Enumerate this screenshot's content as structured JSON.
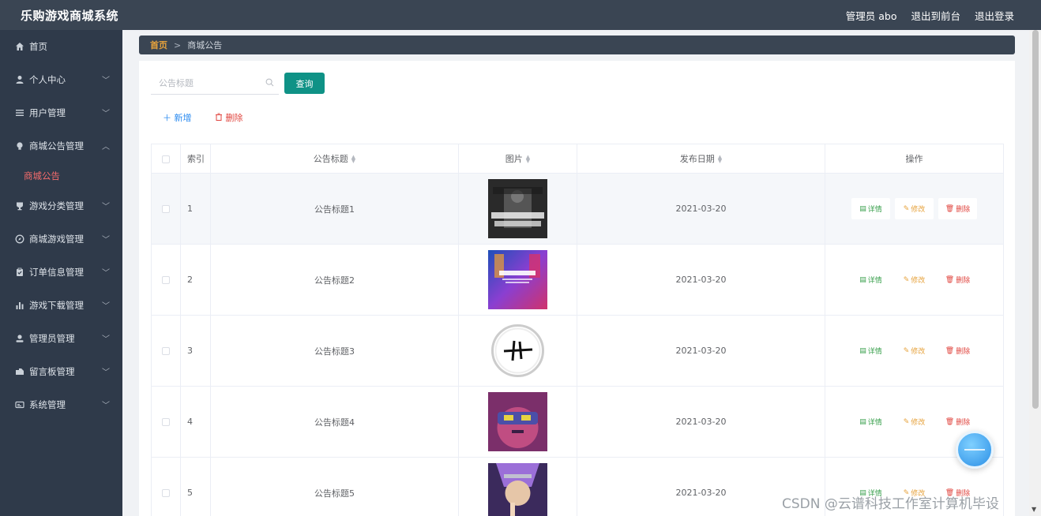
{
  "header": {
    "title": "乐购游戏商城系统",
    "admin": "管理员 abo",
    "to_front": "退出到前台",
    "logout": "退出登录"
  },
  "sidebar": {
    "items": [
      {
        "label": "首页",
        "icon": "home-icon",
        "has_children": false
      },
      {
        "label": "个人中心",
        "icon": "user-icon",
        "has_children": true
      },
      {
        "label": "用户管理",
        "icon": "list-icon",
        "has_children": true
      },
      {
        "label": "商城公告管理",
        "icon": "bulb-icon",
        "has_children": true,
        "expanded": true
      },
      {
        "label": "游戏分类管理",
        "icon": "trophy-icon",
        "has_children": true
      },
      {
        "label": "商城游戏管理",
        "icon": "compass-icon",
        "has_children": true
      },
      {
        "label": "订单信息管理",
        "icon": "clipboard-icon",
        "has_children": true
      },
      {
        "label": "游戏下载管理",
        "icon": "bar-chart-icon",
        "has_children": true
      },
      {
        "label": "管理员管理",
        "icon": "admin-icon",
        "has_children": true
      },
      {
        "label": "留言板管理",
        "icon": "message-icon",
        "has_children": true
      },
      {
        "label": "系统管理",
        "icon": "system-icon",
        "has_children": true
      }
    ],
    "active_sub": "商城公告"
  },
  "breadcrumb": {
    "home": "首页",
    "separator": ">",
    "current": "商城公告"
  },
  "search": {
    "placeholder": "公告标题",
    "query_label": "查询"
  },
  "actions": {
    "add_label": "新增",
    "delete_label": "删除"
  },
  "table": {
    "columns": [
      "索引",
      "公告标题",
      "图片",
      "发布日期",
      "操作"
    ],
    "rows": [
      {
        "index": "1",
        "title": "公告标题1",
        "date": "2021-03-20"
      },
      {
        "index": "2",
        "title": "公告标题2",
        "date": "2021-03-20"
      },
      {
        "index": "3",
        "title": "公告标题3",
        "date": "2021-03-20"
      },
      {
        "index": "4",
        "title": "公告标题4",
        "date": "2021-03-20"
      },
      {
        "index": "5",
        "title": "公告标题5",
        "date": "2021-03-20"
      }
    ],
    "row_actions": {
      "detail": "详情",
      "edit": "修改",
      "remove": "删除"
    }
  },
  "watermark": "CSDN @云谱科技工作室计算机毕设"
}
